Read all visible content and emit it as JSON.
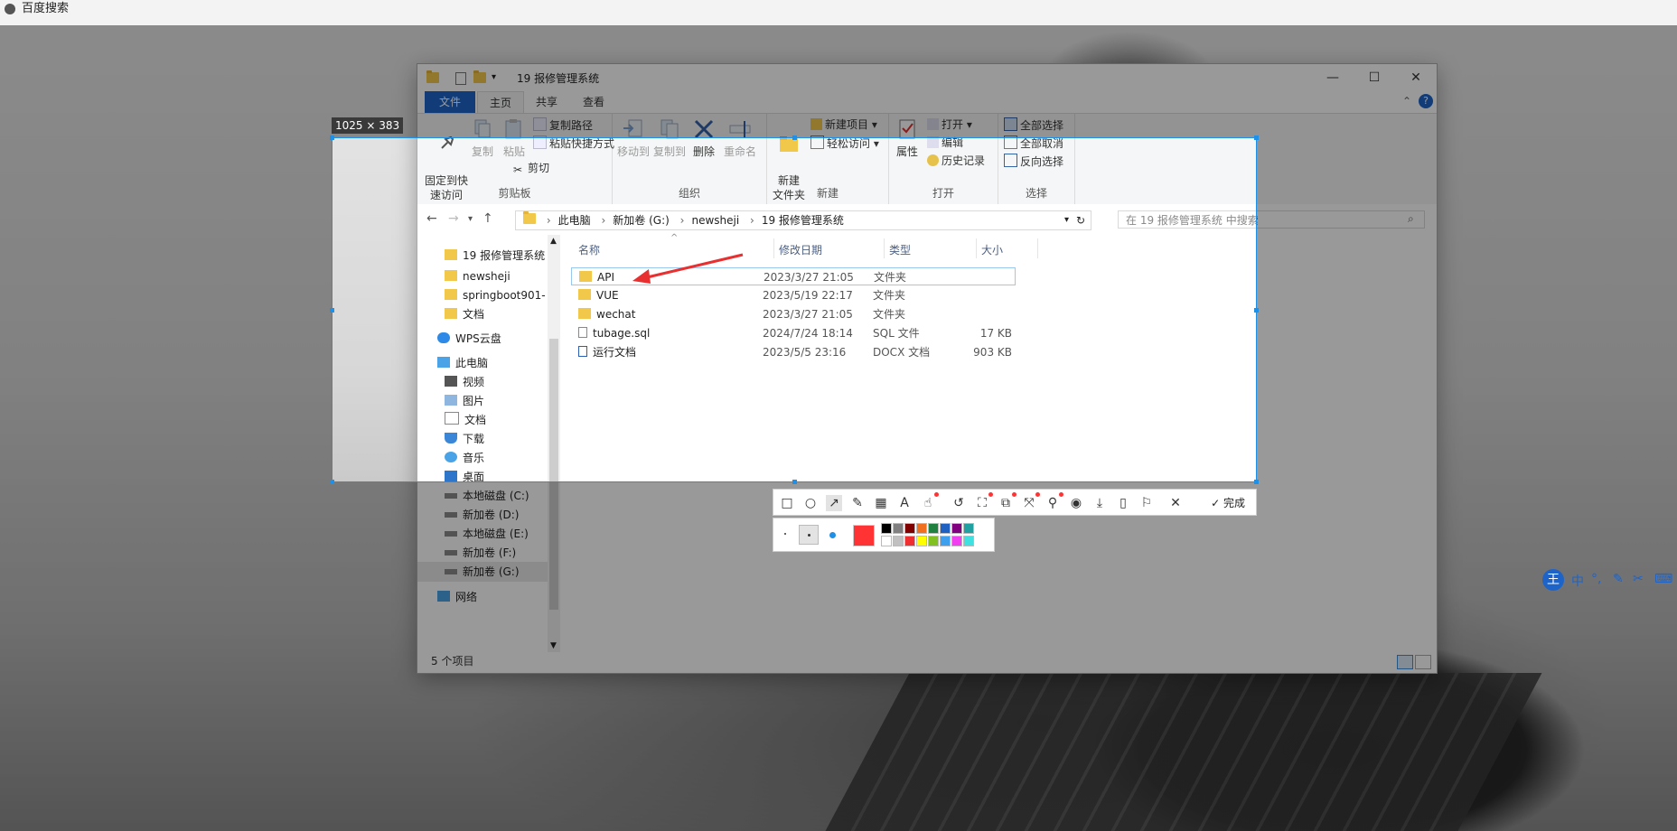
{
  "top_bar": {
    "title": "百度搜索"
  },
  "window": {
    "title": "19 报修管理系统",
    "controls": {
      "minimize": "—",
      "maximize": "☐",
      "close": "✕"
    }
  },
  "ribbon_tabs": [
    "文件",
    "主页",
    "共享",
    "查看"
  ],
  "ribbon": {
    "clipboard": {
      "label": "剪贴板",
      "pin": "固定到快\n速访问",
      "copy": "复制",
      "paste": "粘贴",
      "copy_path": "复制路径",
      "paste_shortcut": "粘贴快捷方式",
      "cut": "剪切"
    },
    "organize": {
      "label": "组织",
      "move_to": "移动到",
      "copy_to": "复制到",
      "delete": "删除",
      "rename": "重命名"
    },
    "new": {
      "label": "新建",
      "new_folder": "新建\n文件夹",
      "new_item": "新建项目",
      "easy_access": "轻松访问"
    },
    "open": {
      "label": "打开",
      "properties": "属性",
      "open": "打开",
      "edit": "编辑",
      "history": "历史记录"
    },
    "select": {
      "label": "选择",
      "select_all": "全部选择",
      "select_none": "全部取消",
      "invert": "反向选择"
    }
  },
  "address": {
    "segments": [
      "此电脑",
      "新加卷 (G:)",
      "newsheji",
      "19 报修管理系统"
    ],
    "search_placeholder": "在 19 报修管理系统 中搜索"
  },
  "nav_items": [
    {
      "label": "19 报修管理系统",
      "icon": "folder-icon"
    },
    {
      "label": "newsheji",
      "icon": "folder-icon"
    },
    {
      "label": "springboot901-",
      "icon": "folder-icon"
    },
    {
      "label": "文档",
      "icon": "folder-icon"
    },
    {
      "label": "WPS云盘",
      "icon": "cloud-icon"
    },
    {
      "label": "此电脑",
      "icon": "pc-icon"
    },
    {
      "label": "视频",
      "icon": "video-icon"
    },
    {
      "label": "图片",
      "icon": "image-icon"
    },
    {
      "label": "文档",
      "icon": "document-icon"
    },
    {
      "label": "下载",
      "icon": "download-icon"
    },
    {
      "label": "音乐",
      "icon": "music-icon"
    },
    {
      "label": "桌面",
      "icon": "desktop-icon"
    },
    {
      "label": "本地磁盘 (C:)",
      "icon": "drive-icon"
    },
    {
      "label": "新加卷 (D:)",
      "icon": "drive-icon"
    },
    {
      "label": "本地磁盘 (E:)",
      "icon": "drive-icon"
    },
    {
      "label": "新加卷 (F:)",
      "icon": "drive-icon"
    },
    {
      "label": "新加卷 (G:)",
      "icon": "drive-icon"
    },
    {
      "label": "网络",
      "icon": "network-icon"
    }
  ],
  "columns": {
    "name": "名称",
    "date": "修改日期",
    "type": "类型",
    "size": "大小"
  },
  "files": [
    {
      "name": "API",
      "date": "2023/3/27 21:05",
      "type": "文件夹",
      "size": "",
      "icon": "folder-icon"
    },
    {
      "name": "VUE",
      "date": "2023/5/19 22:17",
      "type": "文件夹",
      "size": "",
      "icon": "folder-icon"
    },
    {
      "name": "wechat",
      "date": "2023/3/27 21:05",
      "type": "文件夹",
      "size": "",
      "icon": "folder-icon"
    },
    {
      "name": "tubage.sql",
      "date": "2024/7/24 18:14",
      "type": "SQL 文件",
      "size": "17 KB",
      "icon": "file-icon"
    },
    {
      "name": "运行文档",
      "date": "2023/5/5 23:16",
      "type": "DOCX 文档",
      "size": "903 KB",
      "icon": "word-icon"
    }
  ],
  "status": "5 个项目",
  "capture": {
    "size_label": "1025 × 383",
    "done_label": "完成",
    "selected_color": "#ff3333",
    "palette_top": [
      "#000000",
      "#808080",
      "#800000",
      "#f07020",
      "#208040",
      "#2060c0",
      "#800080",
      "#20a0a0"
    ],
    "palette_bottom": [
      "#ffffff",
      "#c0c0c0",
      "#f03030",
      "#ffff00",
      "#80c020",
      "#40a0f0",
      "#f040f0",
      "#40e0e0"
    ]
  },
  "ime": {
    "lang": "中",
    "logo": "王"
  }
}
